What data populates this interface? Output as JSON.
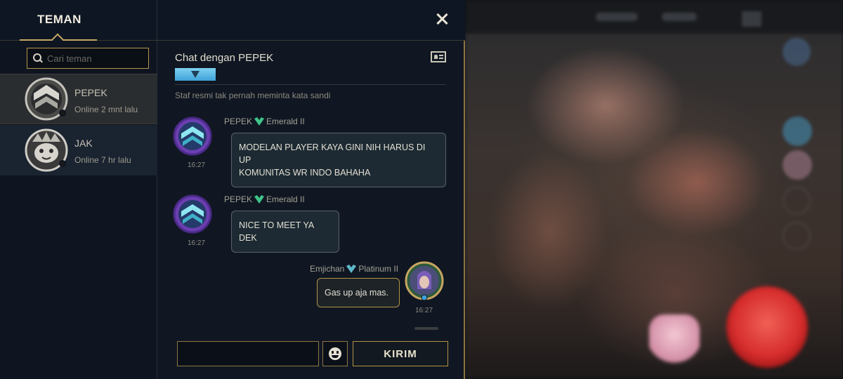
{
  "friends_panel": {
    "title": "TEMAN",
    "search_placeholder": "Cari teman",
    "friends": [
      {
        "name": "PEPEK",
        "status": "Online 2 mnt lalu"
      },
      {
        "name": "JAK",
        "status": "Online 7 hr lalu"
      }
    ]
  },
  "chat": {
    "title": "Chat dengan PEPEK",
    "notice": "Staf resmi tak pernah meminta kata sandi",
    "messages": [
      {
        "sender": "PEPEK",
        "rank": "Emerald II",
        "text_line1": "MODELAN PLAYER KAYA GINI NIH HARUS DI UP",
        "text_line2": "KOMUNITAS WR INDO BAHAHA",
        "time": "16:27"
      },
      {
        "sender": "PEPEK",
        "rank": "Emerald II",
        "text": "NICE TO MEET YA DEK",
        "time": "16:27"
      },
      {
        "sender": "Emjichan",
        "rank": "Platinum II",
        "text": "Gas up aja mas.",
        "time": "16:27"
      }
    ],
    "input_value": "",
    "send_label": "KIRIM"
  },
  "colors": {
    "gold_accent": "#c7a662",
    "emerald": "#3fc48a",
    "platinum": "#5fb9c9",
    "rank_strip": "#7ed1f2"
  },
  "icons": [
    "close-icon",
    "search-icon",
    "profile-card-icon",
    "emoji-icon",
    "emerald-rank-icon",
    "platinum-rank-icon"
  ]
}
